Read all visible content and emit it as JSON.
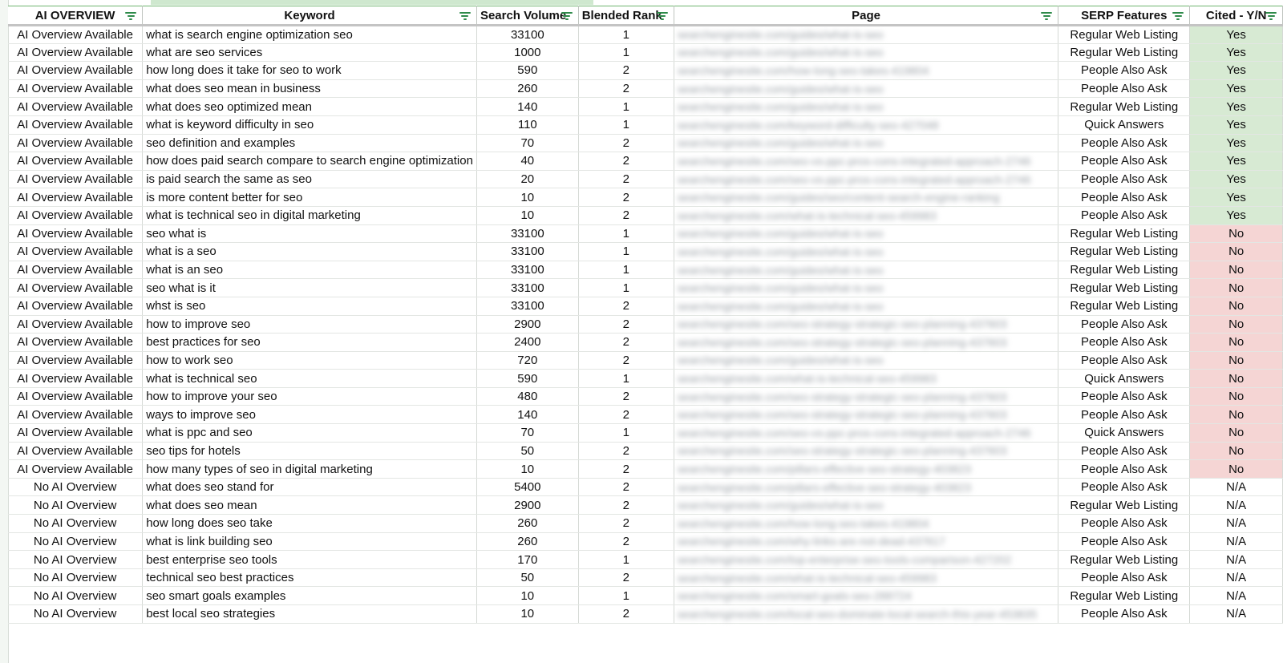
{
  "columns": [
    {
      "key": "ai_overview",
      "label": "AI OVERVIEW"
    },
    {
      "key": "keyword",
      "label": "Keyword"
    },
    {
      "key": "volume",
      "label": "Search Volume"
    },
    {
      "key": "rank",
      "label": "Blended Rank"
    },
    {
      "key": "page",
      "label": "Page"
    },
    {
      "key": "serp",
      "label": "SERP Features"
    },
    {
      "key": "cited",
      "label": "Cited - Y/N"
    }
  ],
  "rows": [
    {
      "ai_overview": "AI Overview Available",
      "keyword": "what is search engine optimization seo",
      "volume": "33100",
      "rank": "1",
      "page": "searchenginesite.com/guides/what-is-seo",
      "serp": "Regular Web Listing",
      "cited": "Yes"
    },
    {
      "ai_overview": "AI Overview Available",
      "keyword": "what are seo services",
      "volume": "1000",
      "rank": "1",
      "page": "searchenginesite.com/guides/what-is-seo",
      "serp": "Regular Web Listing",
      "cited": "Yes"
    },
    {
      "ai_overview": "AI Overview Available",
      "keyword": "how long does it take for seo to work",
      "volume": "590",
      "rank": "2",
      "page": "searchenginesite.com/how-long-seo-takes-419804",
      "serp": "People Also Ask",
      "cited": "Yes"
    },
    {
      "ai_overview": "AI Overview Available",
      "keyword": "what does seo mean in business",
      "volume": "260",
      "rank": "2",
      "page": "searchenginesite.com/guides/what-is-seo",
      "serp": "People Also Ask",
      "cited": "Yes"
    },
    {
      "ai_overview": "AI Overview Available",
      "keyword": "what does seo optimized mean",
      "volume": "140",
      "rank": "1",
      "page": "searchenginesite.com/guides/what-is-seo",
      "serp": "Regular Web Listing",
      "cited": "Yes"
    },
    {
      "ai_overview": "AI Overview Available",
      "keyword": "what is keyword difficulty in seo",
      "volume": "110",
      "rank": "1",
      "page": "searchenginesite.com/keyword-difficulty-seo-427048",
      "serp": "Quick Answers",
      "cited": "Yes"
    },
    {
      "ai_overview": "AI Overview Available",
      "keyword": "seo definition and examples",
      "volume": "70",
      "rank": "2",
      "page": "searchenginesite.com/guides/what-is-seo",
      "serp": "People Also Ask",
      "cited": "Yes"
    },
    {
      "ai_overview": "AI Overview Available",
      "keyword": "how does paid search compare to search engine optimization",
      "volume": "40",
      "rank": "2",
      "page": "searchenginesite.com/seo-vs-ppc-pros-cons-integrated-approach-2746",
      "serp": "People Also Ask",
      "cited": "Yes"
    },
    {
      "ai_overview": "AI Overview Available",
      "keyword": "is paid search the same as seo",
      "volume": "20",
      "rank": "2",
      "page": "searchenginesite.com/seo-vs-ppc-pros-cons-integrated-approach-2746",
      "serp": "People Also Ask",
      "cited": "Yes"
    },
    {
      "ai_overview": "AI Overview Available",
      "keyword": "is more content better for seo",
      "volume": "10",
      "rank": "2",
      "page": "searchenginesite.com/guides/seo/content-search-engine-ranking",
      "serp": "People Also Ask",
      "cited": "Yes"
    },
    {
      "ai_overview": "AI Overview Available",
      "keyword": "what is technical seo in digital marketing",
      "volume": "10",
      "rank": "2",
      "page": "searchenginesite.com/what-is-technical-seo-459983",
      "serp": "People Also Ask",
      "cited": "Yes"
    },
    {
      "ai_overview": "AI Overview Available",
      "keyword": "seo what is",
      "volume": "33100",
      "rank": "1",
      "page": "searchenginesite.com/guides/what-is-seo",
      "serp": "Regular Web Listing",
      "cited": "No"
    },
    {
      "ai_overview": "AI Overview Available",
      "keyword": "what is a seo",
      "volume": "33100",
      "rank": "1",
      "page": "searchenginesite.com/guides/what-is-seo",
      "serp": "Regular Web Listing",
      "cited": "No"
    },
    {
      "ai_overview": "AI Overview Available",
      "keyword": "what is an seo",
      "volume": "33100",
      "rank": "1",
      "page": "searchenginesite.com/guides/what-is-seo",
      "serp": "Regular Web Listing",
      "cited": "No"
    },
    {
      "ai_overview": "AI Overview Available",
      "keyword": "seo what is it",
      "volume": "33100",
      "rank": "1",
      "page": "searchenginesite.com/guides/what-is-seo",
      "serp": "Regular Web Listing",
      "cited": "No"
    },
    {
      "ai_overview": "AI Overview Available",
      "keyword": "whst is seo",
      "volume": "33100",
      "rank": "2",
      "page": "searchenginesite.com/guides/what-is-seo",
      "serp": "Regular Web Listing",
      "cited": "No"
    },
    {
      "ai_overview": "AI Overview Available",
      "keyword": "how to improve seo",
      "volume": "2900",
      "rank": "2",
      "page": "searchenginesite.com/seo-strategy-strategic-seo-planning-437603",
      "serp": "People Also Ask",
      "cited": "No"
    },
    {
      "ai_overview": "AI Overview Available",
      "keyword": "best practices for seo",
      "volume": "2400",
      "rank": "2",
      "page": "searchenginesite.com/seo-strategy-strategic-seo-planning-437603",
      "serp": "People Also Ask",
      "cited": "No"
    },
    {
      "ai_overview": "AI Overview Available",
      "keyword": "how to work seo",
      "volume": "720",
      "rank": "2",
      "page": "searchenginesite.com/guides/what-is-seo",
      "serp": "People Also Ask",
      "cited": "No"
    },
    {
      "ai_overview": "AI Overview Available",
      "keyword": "what is technical seo",
      "volume": "590",
      "rank": "1",
      "page": "searchenginesite.com/what-is-technical-seo-459983",
      "serp": "Quick Answers",
      "cited": "No"
    },
    {
      "ai_overview": "AI Overview Available",
      "keyword": "how to improve your seo",
      "volume": "480",
      "rank": "2",
      "page": "searchenginesite.com/seo-strategy-strategic-seo-planning-437603",
      "serp": "People Also Ask",
      "cited": "No"
    },
    {
      "ai_overview": "AI Overview Available",
      "keyword": "ways to improve seo",
      "volume": "140",
      "rank": "2",
      "page": "searchenginesite.com/seo-strategy-strategic-seo-planning-437603",
      "serp": "People Also Ask",
      "cited": "No"
    },
    {
      "ai_overview": "AI Overview Available",
      "keyword": "what is ppc and seo",
      "volume": "70",
      "rank": "1",
      "page": "searchenginesite.com/seo-vs-ppc-pros-cons-integrated-approach-2746",
      "serp": "Quick Answers",
      "cited": "No"
    },
    {
      "ai_overview": "AI Overview Available",
      "keyword": "seo tips for hotels",
      "volume": "50",
      "rank": "2",
      "page": "searchenginesite.com/seo-strategy-strategic-seo-planning-437603",
      "serp": "People Also Ask",
      "cited": "No"
    },
    {
      "ai_overview": "AI Overview Available",
      "keyword": "how many types of seo in digital marketing",
      "volume": "10",
      "rank": "2",
      "page": "searchenginesite.com/pillars-effective-seo-strategy-403823",
      "serp": "People Also Ask",
      "cited": "No"
    },
    {
      "ai_overview": "No AI Overview",
      "keyword": "what does seo stand for",
      "volume": "5400",
      "rank": "2",
      "page": "searchenginesite.com/pillars-effective-seo-strategy-403823",
      "serp": "People Also Ask",
      "cited": "N/A"
    },
    {
      "ai_overview": "No AI Overview",
      "keyword": "what does seo mean",
      "volume": "2900",
      "rank": "2",
      "page": "searchenginesite.com/guides/what-is-seo",
      "serp": "Regular Web Listing",
      "cited": "N/A"
    },
    {
      "ai_overview": "No AI Overview",
      "keyword": "how long does seo take",
      "volume": "260",
      "rank": "2",
      "page": "searchenginesite.com/how-long-seo-takes-419804",
      "serp": "People Also Ask",
      "cited": "N/A"
    },
    {
      "ai_overview": "No AI Overview",
      "keyword": "what is link building seo",
      "volume": "260",
      "rank": "2",
      "page": "searchenginesite.com/why-links-are-not-dead-437617",
      "serp": "People Also Ask",
      "cited": "N/A"
    },
    {
      "ai_overview": "No AI Overview",
      "keyword": "best enterprise seo tools",
      "volume": "170",
      "rank": "1",
      "page": "searchenginesite.com/top-enterprise-seo-tools-comparison-427202",
      "serp": "Regular Web Listing",
      "cited": "N/A"
    },
    {
      "ai_overview": "No AI Overview",
      "keyword": "technical seo best practices",
      "volume": "50",
      "rank": "2",
      "page": "searchenginesite.com/what-is-technical-seo-459983",
      "serp": "People Also Ask",
      "cited": "N/A"
    },
    {
      "ai_overview": "No AI Overview",
      "keyword": "seo smart goals examples",
      "volume": "10",
      "rank": "1",
      "page": "searchenginesite.com/smart-goals-seo-288724",
      "serp": "Regular Web Listing",
      "cited": "N/A"
    },
    {
      "ai_overview": "No AI Overview",
      "keyword": "best local seo strategies",
      "volume": "10",
      "rank": "2",
      "page": "searchenginesite.com/local-seo-dominate-local-search-this-year-453835",
      "serp": "People Also Ask",
      "cited": "N/A"
    }
  ],
  "colors": {
    "yes_bg": "#d7ead3",
    "no_bg": "#f5d5d4",
    "filter_icon": "#2e8b4a",
    "header_border": "#6fb56f"
  },
  "icons": {
    "filter": "filter-icon"
  }
}
